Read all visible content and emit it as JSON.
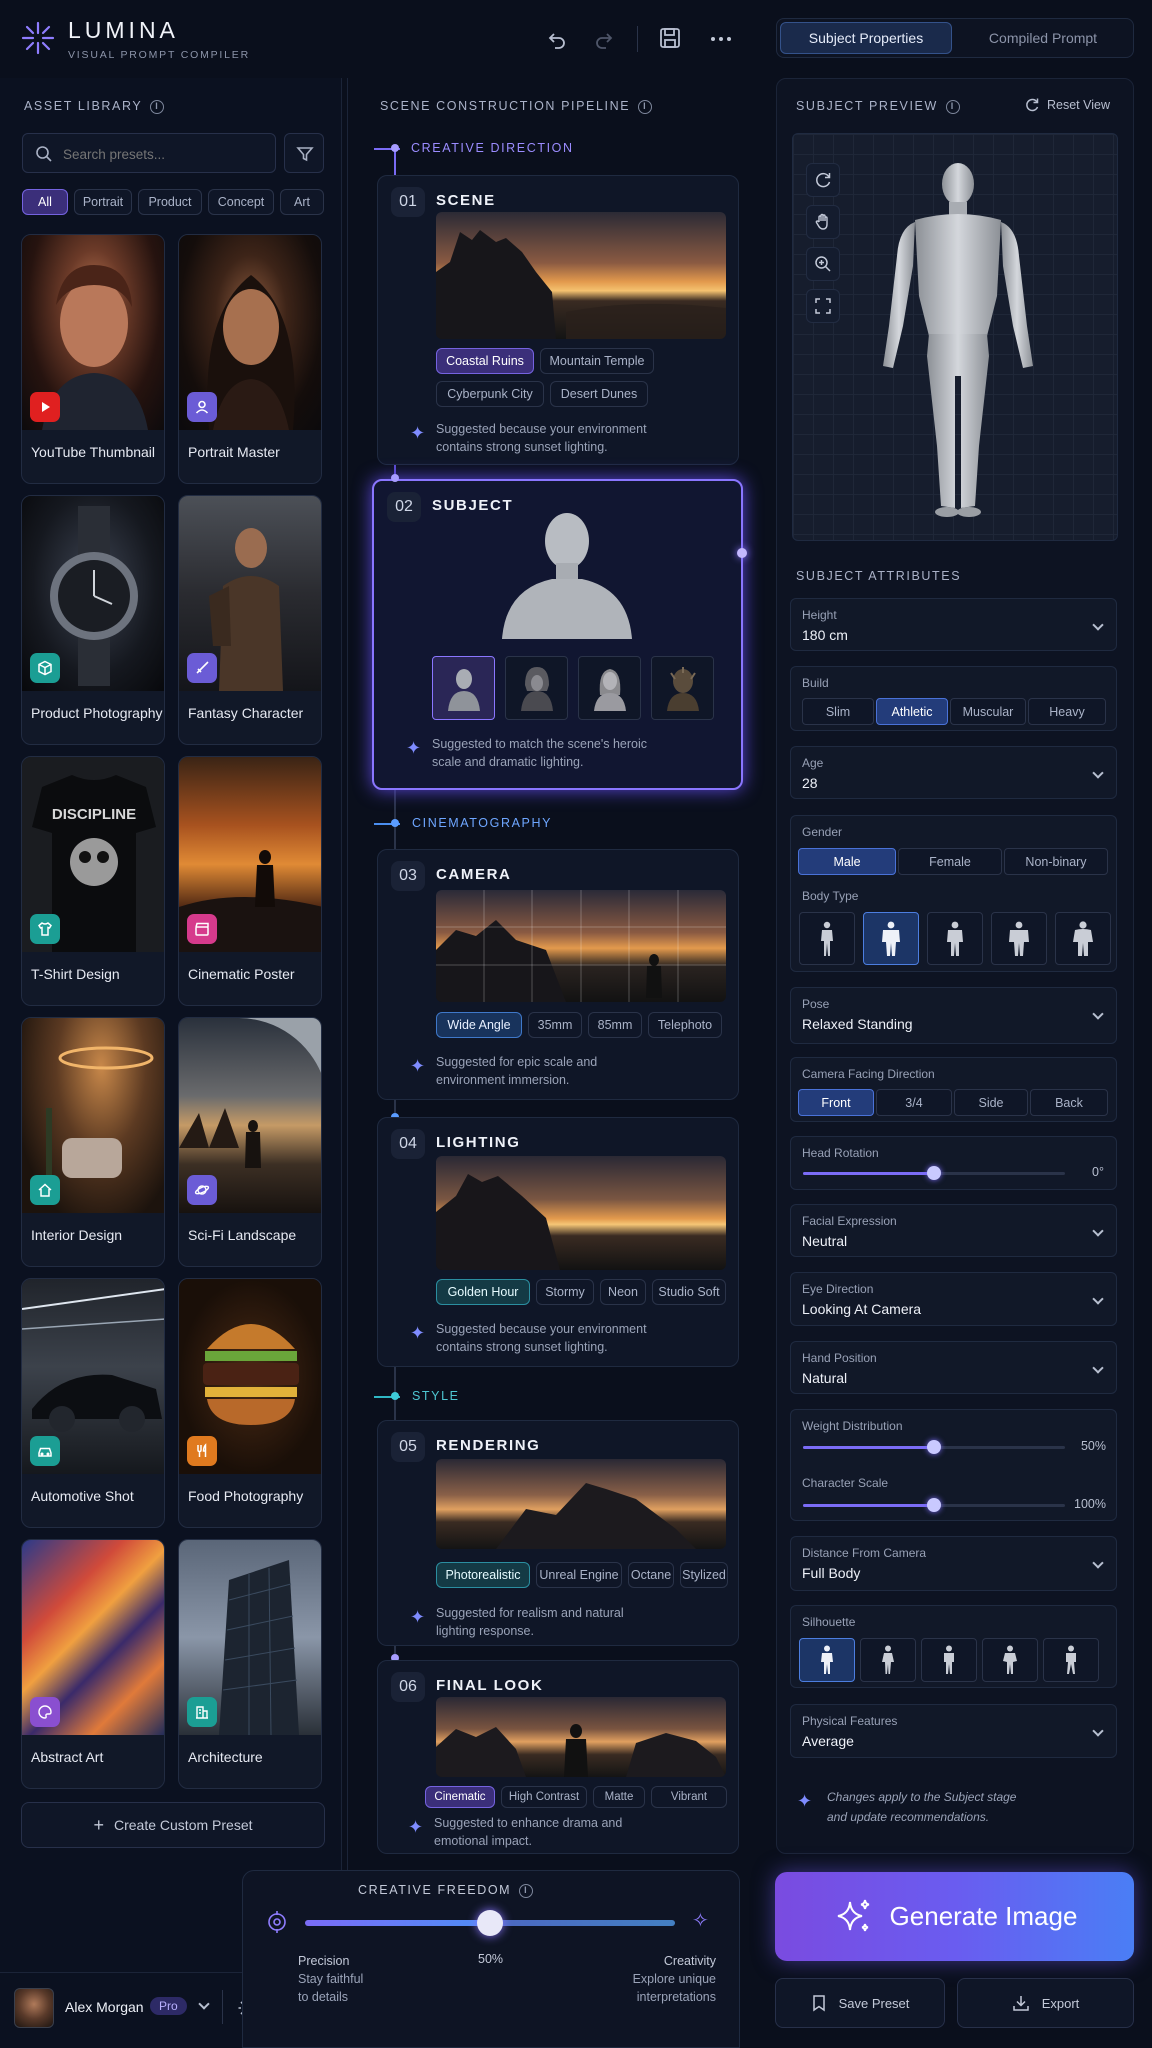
{
  "app": {
    "name": "LUMINA",
    "subtitle": "VISUAL PROMPT COMPILER"
  },
  "asset_library": {
    "title": "ASSET LIBRARY",
    "search_placeholder": "Search presets...",
    "filters": [
      "All",
      "Portrait",
      "Product",
      "Concept",
      "Art"
    ],
    "presets": [
      {
        "label": "YouTube Thumbnail",
        "icon": "youtube-icon",
        "color": "#e02020"
      },
      {
        "label": "Portrait Master",
        "icon": "user-icon",
        "color": "#6b5cd6"
      },
      {
        "label": "Product Photography",
        "icon": "cube-icon",
        "color": "#1b9e94"
      },
      {
        "label": "Fantasy Character",
        "icon": "sword-icon",
        "color": "#6b5cd6"
      },
      {
        "label": "T-Shirt Design",
        "icon": "shirt-icon",
        "color": "#1b9e94"
      },
      {
        "label": "Cinematic Poster",
        "icon": "clapper-icon",
        "color": "#d63a8c"
      },
      {
        "label": "Interior Design",
        "icon": "home-icon",
        "color": "#1b9e94"
      },
      {
        "label": "Sci-Fi Landscape",
        "icon": "planet-icon",
        "color": "#6b5cd6"
      },
      {
        "label": "Automotive Shot",
        "icon": "car-icon",
        "color": "#1b9e94"
      },
      {
        "label": "Food Photography",
        "icon": "fork-icon",
        "color": "#e07a1f"
      },
      {
        "label": "Abstract Art",
        "icon": "palette-icon",
        "color": "#8a4fd0"
      },
      {
        "label": "Architecture",
        "icon": "building-icon",
        "color": "#1b9e94"
      }
    ],
    "tshirt_text": "DISCIPLINE",
    "create_label": "Create Custom Preset"
  },
  "pipeline": {
    "title": "SCENE CONSTRUCTION PIPELINE",
    "groups": [
      "CREATIVE DIRECTION",
      "CINEMATOGRAPHY",
      "STYLE"
    ],
    "stages": [
      {
        "num": "01",
        "title": "SCENE",
        "chips": [
          "Coastal Ruins",
          "Mountain Temple",
          "Cyberpunk City",
          "Desert Dunes"
        ],
        "suggest1": "Suggested because your environment",
        "suggest2": "contains strong sunset lighting."
      },
      {
        "num": "02",
        "title": "SUBJECT",
        "suggest1": "Suggested to match the scene's heroic",
        "suggest2": "scale and dramatic lighting."
      },
      {
        "num": "03",
        "title": "CAMERA",
        "chips": [
          "Wide Angle",
          "35mm",
          "85mm",
          "Telephoto"
        ],
        "suggest1": "Suggested for epic scale and",
        "suggest2": "environment immersion."
      },
      {
        "num": "04",
        "title": "LIGHTING",
        "chips": [
          "Golden Hour",
          "Stormy",
          "Neon",
          "Studio Soft"
        ],
        "suggest1": "Suggested because your environment",
        "suggest2": "contains strong sunset lighting."
      },
      {
        "num": "05",
        "title": "RENDERING",
        "chips": [
          "Photorealistic",
          "Unreal Engine",
          "Octane",
          "Stylized"
        ],
        "suggest1": "Suggested for realism and natural",
        "suggest2": "lighting response."
      },
      {
        "num": "06",
        "title": "FINAL LOOK",
        "chips": [
          "Cinematic",
          "High Contrast",
          "Matte",
          "Vibrant"
        ],
        "suggest1": "Suggested to enhance drama and",
        "suggest2": "emotional impact."
      }
    ]
  },
  "creative_freedom": {
    "title": "CREATIVE FREEDOM",
    "value_label": "50%",
    "value": 0.5,
    "left_title": "Precision",
    "left_1": "Stay faithful",
    "left_2": "to details",
    "right_title": "Creativity",
    "right_1": "Explore unique",
    "right_2": "interpretations"
  },
  "user": {
    "name": "Alex Morgan",
    "plan": "Pro"
  },
  "right": {
    "tabs": [
      "Subject Properties",
      "Compiled Prompt"
    ],
    "preview_title": "SUBJECT PREVIEW",
    "reset_label": "Reset View",
    "attributes_title": "SUBJECT ATTRIBUTES",
    "height": {
      "label": "Height",
      "value": "180 cm"
    },
    "build": {
      "label": "Build",
      "options": [
        "Slim",
        "Athletic",
        "Muscular",
        "Heavy"
      ]
    },
    "age": {
      "label": "Age",
      "value": "28"
    },
    "gender": {
      "label": "Gender",
      "options": [
        "Male",
        "Female",
        "Non-binary"
      ]
    },
    "body_type_label": "Body Type",
    "pose": {
      "label": "Pose",
      "value": "Relaxed Standing"
    },
    "facing": {
      "label": "Camera Facing Direction",
      "options": [
        "Front",
        "3/4",
        "Side",
        "Back"
      ]
    },
    "head_rotation": {
      "label": "Head Rotation",
      "value_label": "0°",
      "value": 0.5
    },
    "expression": {
      "label": "Facial Expression",
      "value": "Neutral"
    },
    "eye": {
      "label": "Eye Direction",
      "value": "Looking At Camera"
    },
    "hand": {
      "label": "Hand Position",
      "value": "Natural"
    },
    "weight": {
      "label": "Weight Distribution",
      "value_label": "50%",
      "value": 0.5
    },
    "scale": {
      "label": "Character Scale",
      "value_label": "100%",
      "value": 0.5
    },
    "distance": {
      "label": "Distance From Camera",
      "value": "Full Body"
    },
    "silhouette_label": "Silhouette",
    "physical": {
      "label": "Physical Features",
      "value": "Average"
    },
    "note1": "Changes apply to the Subject stage",
    "note2": "and update recommendations.",
    "generate_label": "Generate Image",
    "save_label": "Save Preset",
    "export_label": "Export"
  }
}
